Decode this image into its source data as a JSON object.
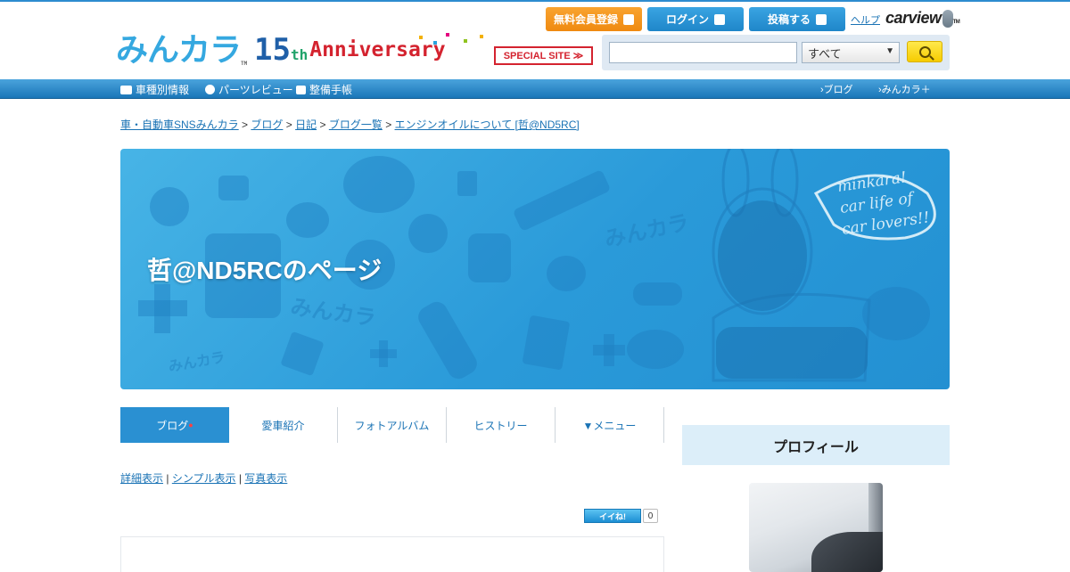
{
  "header": {
    "logo": "みんカラ",
    "logo_tm": "TM",
    "anniversary_number": "15",
    "anniversary_suffix": "th",
    "anniversary_word": "Anniversary",
    "special_site": "SPECIAL SITE ≫",
    "register_label": "無料会員登録",
    "login_label": "ログイン",
    "post_label": "投稿する",
    "help_label": "ヘルプ",
    "carview_label": "carview",
    "carview_tm": "TM"
  },
  "search": {
    "input_value": "",
    "select_value": "すべて",
    "select_arrow": "▼"
  },
  "nav": {
    "items": [
      {
        "label": "車種別情報",
        "icon": "car-icon"
      },
      {
        "label": "パーツレビュー",
        "icon": "parts-icon"
      },
      {
        "label": "整備手帳",
        "icon": "wrench-icon"
      }
    ],
    "right": [
      {
        "label": "ブログ"
      },
      {
        "label": "みんカラ＋"
      }
    ]
  },
  "breadcrumb": {
    "items": [
      "車・自動車SNSみんカラ",
      "ブログ",
      "日記",
      "ブログ一覧",
      "エンジンオイルについて [哲@ND5RC]"
    ],
    "separator": ">"
  },
  "banner": {
    "title": "哲@ND5RCのページ",
    "bubble_text": [
      "minkara!",
      "car life of",
      "car lovers!!"
    ],
    "watermark": "みんカラ"
  },
  "tabs": [
    {
      "label": "ブログ",
      "marker": "●",
      "active": true
    },
    {
      "label": "愛車紹介",
      "active": false
    },
    {
      "label": "フォトアルバム",
      "active": false
    },
    {
      "label": "ヒストリー",
      "active": false
    },
    {
      "label": "▼メニュー",
      "active": false
    }
  ],
  "view_modes": [
    "詳細表示",
    "シンプル表示",
    "写真表示"
  ],
  "view_mode_separator": "|",
  "iine": {
    "label": "イイね!",
    "count": "0"
  },
  "sidebar": {
    "profile_heading": "プロフィール"
  },
  "colors": {
    "accent": "#2a90d2",
    "register": "#ef8a10",
    "nav": "#1a76b8",
    "link": "#1a73b5",
    "anniversary_red": "#d4232f"
  }
}
